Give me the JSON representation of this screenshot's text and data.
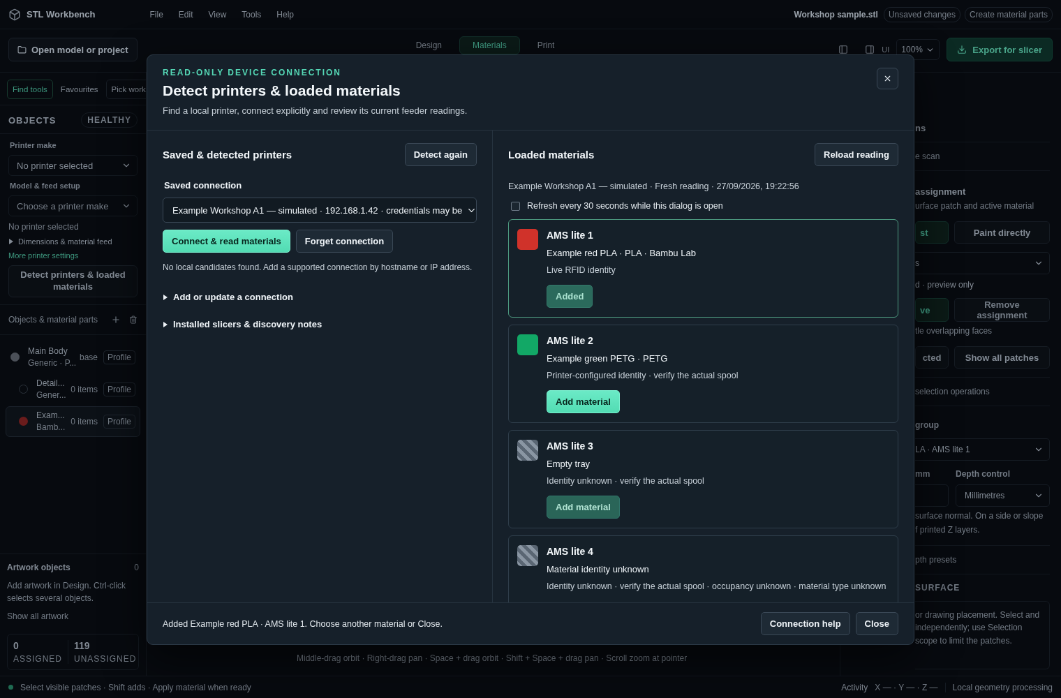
{
  "app": {
    "title": "STL Workbench",
    "menu": [
      "File",
      "Edit",
      "View",
      "Tools",
      "Help"
    ],
    "file_name": "Workshop sample.stl",
    "badges": [
      "Unsaved changes",
      "Create material parts"
    ]
  },
  "toolbar": {
    "open_button": "Open model or project",
    "tabs": [
      {
        "label": "Design",
        "selected": false
      },
      {
        "label": "Materials",
        "selected": true
      },
      {
        "label": "Print",
        "selected": false
      }
    ],
    "ui_label": "UI",
    "zoom": "100%",
    "export_button": "Export for slicer"
  },
  "sidebar": {
    "tabs": [
      {
        "label": "Find tools",
        "selected": true
      },
      {
        "label": "Favourites",
        "selected": false
      },
      {
        "label": "Pick work",
        "selected": false
      }
    ],
    "heading": "OBJECTS",
    "health": "HEALTHY",
    "printer_make": {
      "label": "Printer make",
      "value": "No printer selected"
    },
    "feed_setup": {
      "label": "Model & feed setup",
      "value": "Choose a printer make",
      "disabled": true
    },
    "status": "No printer selected",
    "disclosure": {
      "label": "Dimensions & material feed",
      "expanded": false
    },
    "link": "More printer settings",
    "detect_button": "Detect printers & loaded materials",
    "parts_heading": "Objects & material parts",
    "objects": [
      {
        "name": "Main Body",
        "detail": "Generic · P...",
        "meta": "base",
        "action": "Profile",
        "color": "#4b5058",
        "selected": false,
        "children": [
          {
            "name": "Detail...",
            "detail": "Gener...",
            "meta": "0 items",
            "action": "Profile",
            "selected": false
          },
          {
            "name": "Exam...",
            "detail": "Bamb...",
            "meta": "0 items",
            "action": "Profile",
            "color": "#6a1c1c",
            "selected": true
          }
        ]
      }
    ],
    "artwork": {
      "heading": "Artwork objects",
      "count": "0",
      "hint": "Add artwork in Design. Ctrl-click selects several objects.",
      "link": "Show all artwork"
    },
    "stats": [
      {
        "value": "0",
        "label": "ASSIGNED"
      },
      {
        "value": "119",
        "label": "UNASSIGNED"
      }
    ]
  },
  "right_panel": [
    {
      "kind": "title",
      "text": "ns"
    },
    {
      "kind": "row",
      "text": "e scan"
    },
    {
      "kind": "heading",
      "text": "assignment"
    },
    {
      "kind": "hint",
      "lines": [
        "urface patch and active material"
      ]
    },
    {
      "kind": "buttons",
      "buttons": [
        {
          "label": "st",
          "selected": true,
          "disabled": false
        },
        {
          "label": "Paint directly",
          "selected": false,
          "disabled": false
        }
      ]
    },
    {
      "kind": "select",
      "value": "s"
    },
    {
      "kind": "note",
      "text": "d · preview only"
    },
    {
      "kind": "buttons",
      "buttons": [
        {
          "label": "ve",
          "selected": true,
          "disabled": false
        },
        {
          "label": "Remove assignment",
          "selected": false,
          "disabled": true
        }
      ]
    },
    {
      "kind": "hint",
      "lines": [
        "tle overlapping faces"
      ]
    },
    {
      "kind": "buttons",
      "buttons": [
        {
          "label": "cted",
          "selected": false,
          "disabled": false
        },
        {
          "label": "Show all patches",
          "selected": false,
          "disabled": false
        }
      ]
    },
    {
      "kind": "row",
      "text": "selection operations"
    },
    {
      "kind": "label",
      "text": "group"
    },
    {
      "kind": "select",
      "value": "LA · AMS lite 1"
    },
    {
      "kind": "pair",
      "label_1": "mm",
      "label_2": "Depth control",
      "value_2": "Millimetres"
    },
    {
      "kind": "hint",
      "lines": [
        "surface normal. On a side or slope",
        "f printed Z layers."
      ]
    },
    {
      "kind": "row",
      "text": "pth presets"
    },
    {
      "kind": "section",
      "text": "SURFACE"
    },
    {
      "kind": "card",
      "lines": [
        "or drawing placement. Select and",
        "independently; use Selection",
        "scope to limit the patches."
      ]
    }
  ],
  "viewport_hint": "Middle-drag orbit · Right-drag pan · Space + drag orbit · Shift + Space + drag pan · Scroll zoom at pointer",
  "status_bar": {
    "message": "Select visible patches · Shift adds · Apply material when ready",
    "activity": "Activity",
    "coords": "X — · Y — · Z —",
    "processing": "Local geometry processing"
  },
  "dialog": {
    "eyebrow": "READ-ONLY DEVICE CONNECTION",
    "title": "Detect printers & loaded materials",
    "subtitle": "Find a local printer, connect explicitly and review its current feeder readings.",
    "printers": {
      "heading": "Saved & detected printers",
      "detect_button": "Detect again",
      "connection_label": "Saved connection",
      "connection_value": "Example Workshop A1 — simulated · 192.168.1.42 · credentials may be",
      "connect_button": "Connect & read materials",
      "forget_button": "Forget connection",
      "note": "No local candidates found. Add a supported connection by hostname or IP address.",
      "sections": [
        {
          "label": "Add or update a connection",
          "expanded": false
        },
        {
          "label": "Installed slicers & discovery notes",
          "expanded": false
        }
      ]
    },
    "materials": {
      "heading": "Loaded materials",
      "reload_button": "Reload reading",
      "status": "Example Workshop A1 — simulated · Fresh reading · 27/09/2026, 19:22:56",
      "refresh": {
        "label": "Refresh every 30 seconds while this dialog is open",
        "checked": false
      },
      "slots": [
        {
          "name": "AMS lite 1",
          "material": "Example red PLA · PLA · Bambu Lab",
          "identity": "Live RFID identity",
          "kind": "color",
          "color": "#d0322a",
          "selected": true,
          "button": {
            "label": "Added",
            "added": true,
            "disabled": false
          }
        },
        {
          "name": "AMS lite 2",
          "material": "Example green PETG · PETG",
          "identity": "Printer-configured identity · verify the actual spool",
          "kind": "color",
          "color": "#12a866",
          "selected": false,
          "button": {
            "label": "Add material",
            "added": false,
            "disabled": false
          }
        },
        {
          "name": "AMS lite 3",
          "material": "Empty tray",
          "identity": "Identity unknown · verify the actual spool",
          "kind": "unknown",
          "selected": false,
          "button": {
            "label": "Add material",
            "added": false,
            "disabled": true
          }
        },
        {
          "name": "AMS lite 4",
          "material": "Material identity unknown",
          "identity": "Identity unknown · verify the actual spool · occupancy unknown · material type unknown",
          "kind": "unknown",
          "selected": false
        }
      ]
    },
    "footer_message": "Added Example red PLA · AMS lite 1. Choose another material or Close.",
    "help_button": "Connection help",
    "close_button": "Close"
  }
}
